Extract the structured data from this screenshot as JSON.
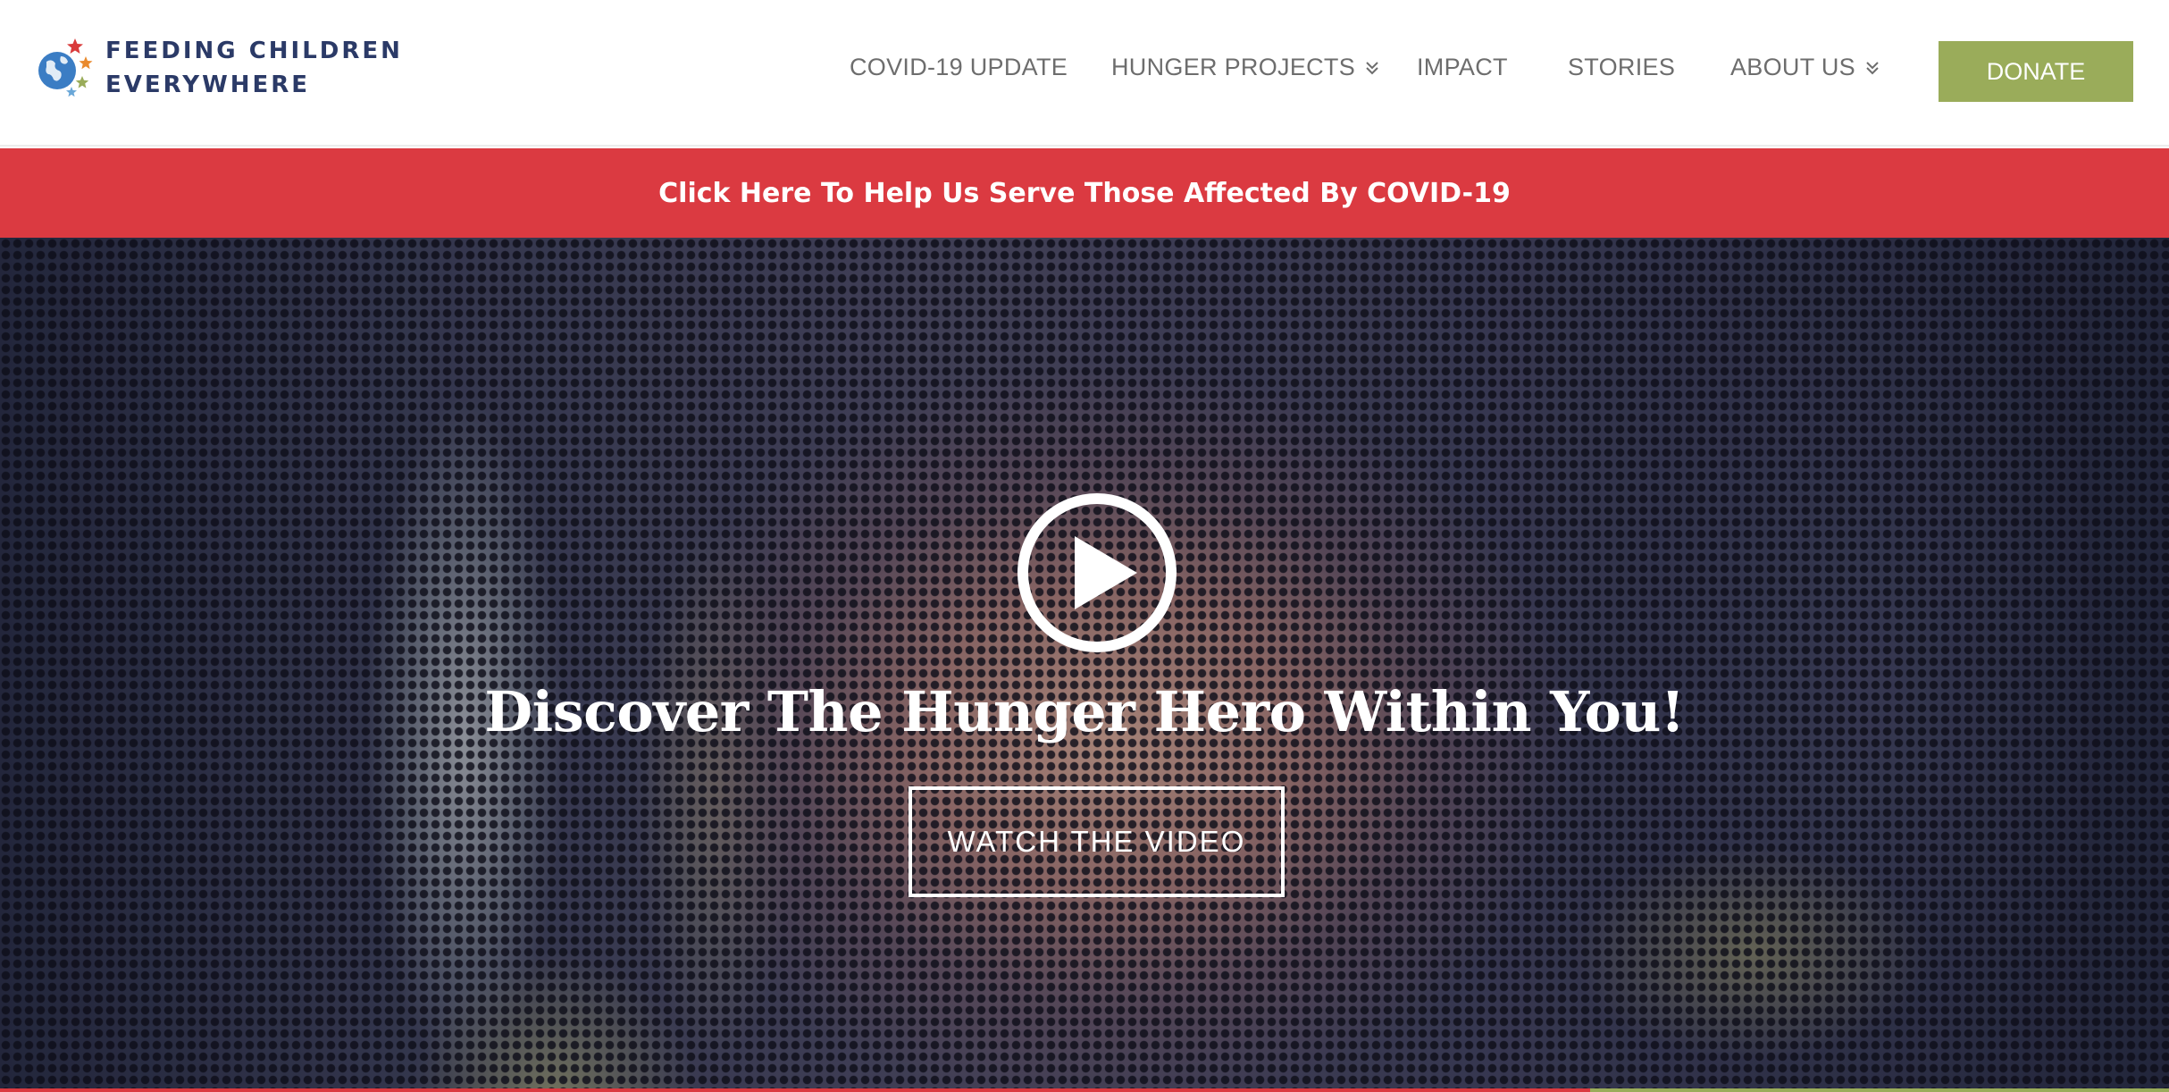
{
  "header": {
    "logo": {
      "line1": "FEEDING CHILDREN",
      "line2": "EVERYWHERE",
      "icon": "globe-stars-icon"
    },
    "nav": {
      "covid": "COVID-19 UPDATE",
      "hunger_projects": "HUNGER PROJECTS",
      "impact": "IMPACT",
      "stories": "STORIES",
      "about_us": "ABOUT US"
    },
    "donate_label": "DONATE"
  },
  "banner": {
    "text": "Click Here To Help Us Serve Those Affected By COVID-19"
  },
  "hero": {
    "title": "Discover The Hunger Hero Within You!",
    "watch_label": "WATCH THE VIDEO",
    "play_icon": "play-circle-icon"
  },
  "colors": {
    "brand_navy": "#2b3a67",
    "donate_green": "#9aac5a",
    "banner_red": "#db3a41",
    "nav_text": "#6d6d6d"
  }
}
